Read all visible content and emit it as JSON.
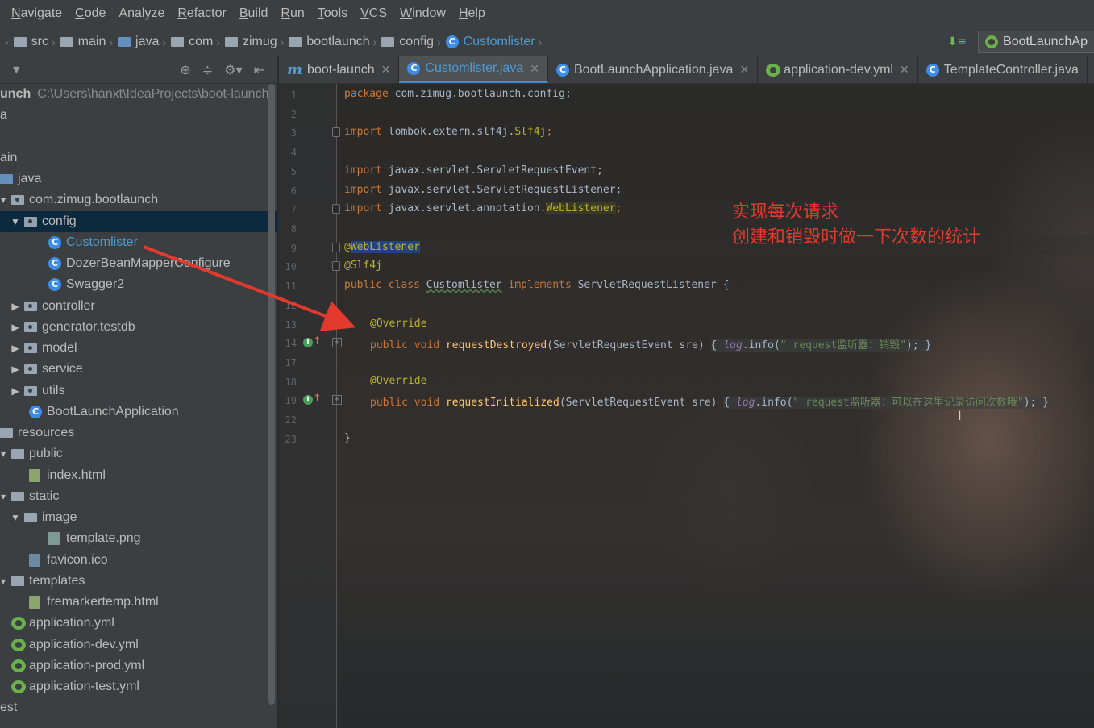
{
  "menu": [
    {
      "label": "Navigate",
      "mn": "N",
      "rest": "avigate"
    },
    {
      "label": "Code",
      "mn": "C",
      "rest": "ode"
    },
    {
      "label": "Analyze",
      "mn": "",
      "rest": "Analyze"
    },
    {
      "label": "Refactor",
      "mn": "R",
      "rest": "efactor"
    },
    {
      "label": "Build",
      "mn": "B",
      "rest": "uild"
    },
    {
      "label": "Run",
      "mn": "R",
      "rest": "un"
    },
    {
      "label": "Tools",
      "mn": "T",
      "rest": "ools"
    },
    {
      "label": "VCS",
      "mn": "V",
      "rest": "CS"
    },
    {
      "label": "Window",
      "mn": "W",
      "rest": "indow"
    },
    {
      "label": "Help",
      "mn": "H",
      "rest": "elp"
    }
  ],
  "breadcrumb": [
    "src",
    "main",
    "java",
    "com",
    "zimug",
    "bootlaunch",
    "config",
    "Customlister"
  ],
  "run_config": "BootLaunchAp",
  "project": {
    "root_name": "unch",
    "root_path": "C:\\Users\\hanxt\\IdeaProjects\\boot-launch",
    "partial_a": "a",
    "items": {
      "main": "ain",
      "java": "java",
      "pkg": "com.zimug.bootlaunch",
      "config": "config",
      "customlister": "Customlister",
      "dozer": "DozerBeanMapperConfigure",
      "swagger": "Swagger2",
      "controller": "controller",
      "generator": "generator.testdb",
      "model": "model",
      "service": "service",
      "utils": "utils",
      "bootapp": "BootLaunchApplication",
      "resources": "resources",
      "public": "public",
      "index": "index.html",
      "static": "static",
      "image": "image",
      "template_png": "template.png",
      "favicon": "favicon.ico",
      "templates": "templates",
      "fremarker": "fremarkertemp.html",
      "app_yml": "application.yml",
      "app_dev": "application-dev.yml",
      "app_prod": "application-prod.yml",
      "app_test": "application-test.yml",
      "test": "est"
    }
  },
  "tabs": [
    {
      "label": "boot-launch",
      "type": "module"
    },
    {
      "label": "Customlister.java",
      "type": "class",
      "active": true
    },
    {
      "label": "BootLaunchApplication.java",
      "type": "spring"
    },
    {
      "label": "application-dev.yml",
      "type": "yml"
    },
    {
      "label": "TemplateController.java",
      "type": "class"
    }
  ],
  "code": {
    "line_numbers": [
      "1",
      "2",
      "3",
      "4",
      "5",
      "6",
      "7",
      "8",
      "9",
      "10",
      "11",
      "12",
      "13",
      "14",
      "17",
      "18",
      "19",
      "22",
      "23"
    ],
    "l1_kw": "package",
    "l1_rest": " com.zimug.bootlaunch.config;",
    "l3_kw": "import",
    "l3_rest": " lombok.extern.slf4j.",
    "l3_cls": "Slf4j",
    "l3_end": ";",
    "l5_kw": "import",
    "l5_rest": " javax.servlet.ServletRequestEvent;",
    "l6_kw": "import",
    "l6_rest": " javax.servlet.ServletRequestListener;",
    "l7_kw": "import",
    "l7_rest": " javax.servlet.annotation.",
    "l7_cls": "WebListener",
    "l7_end": ";",
    "l9_at": "@",
    "l9_ann": "WebListener",
    "l10": "@Slf4j",
    "l11_kw1": "public class ",
    "l11_cls": "Customlister",
    "l11_kw2": " implements ",
    "l11_rest": "ServletRequestListener {",
    "l13": "@Override",
    "l14_kw": "public void ",
    "l14_fn": "requestDestroyed",
    "l14_params": "(ServletRequestEvent sre) ",
    "l14_body_open": "{ ",
    "l14_log": "log",
    "l14_call": ".info(",
    "l14_str": "\" request监听器：销毁\"",
    "l14_close": "); }",
    "l18": "@Override",
    "l19_kw": "public void ",
    "l19_fn": "requestInitialized",
    "l19_params": "(ServletRequestEvent sre) ",
    "l19_body_open": "{ ",
    "l19_log": "log",
    "l19_call": ".info(",
    "l19_str": "\" request监听器：可以在这里记录访问次数哦\"",
    "l19_close": "); }",
    "l23": "}"
  },
  "annotation": {
    "line1": "实现每次请求",
    "line2": "创建和销毁时做一下次数的统计",
    "color": "#e23a2e"
  }
}
